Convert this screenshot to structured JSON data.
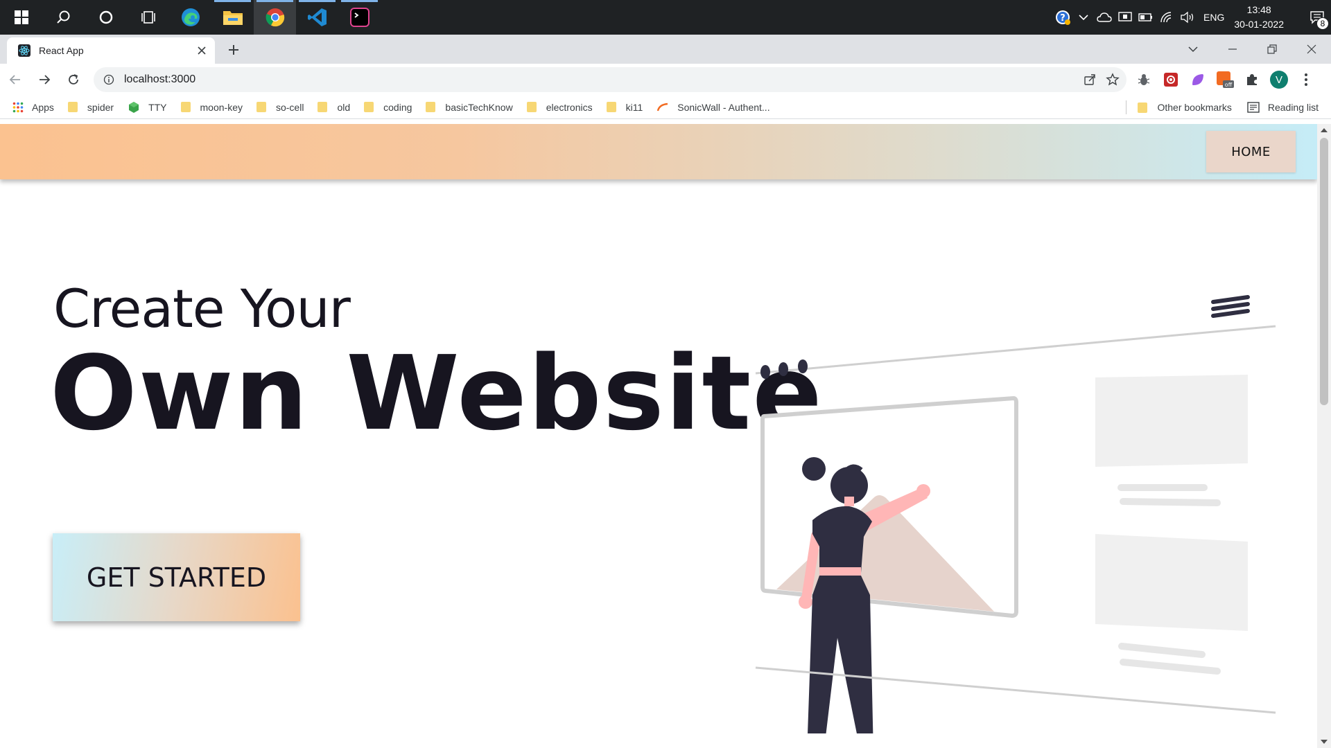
{
  "taskbar": {
    "apps": [
      "windows-start",
      "search",
      "cortana",
      "task-view",
      "edge",
      "file-explorer",
      "chrome",
      "vscode",
      "terminal"
    ],
    "lang": "ENG",
    "time": "13:48",
    "date": "30-01-2022",
    "notification_count": "8"
  },
  "browser": {
    "tab_title": "React App",
    "url": "localhost:3000",
    "profile_initial": "V"
  },
  "bookmarks": {
    "items": [
      "Apps",
      "spider",
      "TTY",
      "moon-key",
      "so-cell",
      "old",
      "coding",
      "basicTechKnow",
      "electronics",
      "ki11",
      "SonicWall - Authent..."
    ],
    "other": "Other bookmarks",
    "reading_list": "Reading list"
  },
  "page": {
    "nav_home": "HOME",
    "headline_1": "Create Your",
    "headline_2": "Own Website",
    "cta": "GET STARTED"
  },
  "colors": {
    "navbar_gradient": [
      "#fbc290",
      "#c5ecf7"
    ],
    "home_button": "#ead6ca",
    "text_dark": "#171520"
  }
}
